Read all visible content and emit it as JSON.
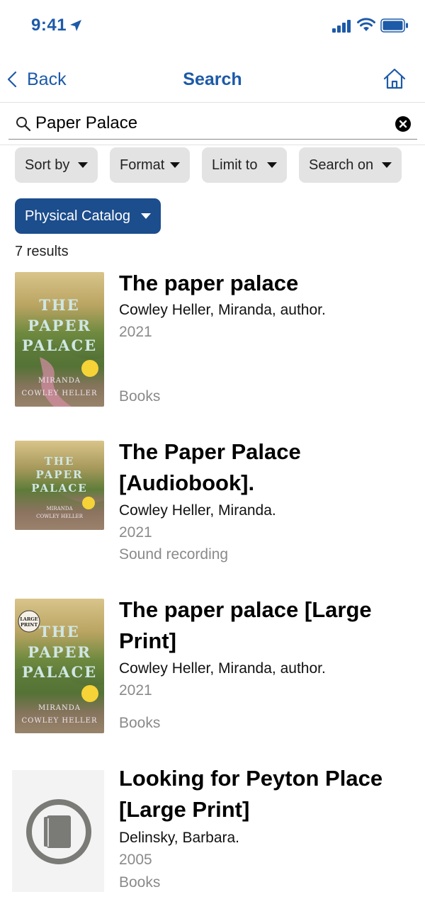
{
  "status_bar": {
    "time": "9:41"
  },
  "nav": {
    "back_label": "Back",
    "title": "Search"
  },
  "search": {
    "value": "Paper Palace",
    "placeholder": ""
  },
  "filters": [
    {
      "label": "Sort by"
    },
    {
      "label": "Format"
    },
    {
      "label": "Limit to"
    },
    {
      "label": "Search on"
    }
  ],
  "catalog_selector": {
    "label": "Physical Catalog"
  },
  "results_count": "7 results",
  "results": [
    {
      "title": "The paper palace",
      "author": "Cowley Heller, Miranda, author.",
      "year": "2021",
      "format": "Books",
      "cover": {
        "line1": "THE",
        "line2": "PAPER",
        "line3": "PALACE",
        "author_line1": "MIRANDA",
        "author_line2": "COWLEY HELLER"
      }
    },
    {
      "title": "The Paper Palace [Audiobook].",
      "author": "Cowley Heller, Miranda.",
      "year": "2021",
      "format": "Sound recording",
      "cover": {
        "line1": "THE",
        "line2": "PAPER",
        "line3": "PALACE",
        "author_line1": "MIRANDA",
        "author_line2": "COWLEY HELLER"
      }
    },
    {
      "title": "The paper palace [Large Print]",
      "author": "Cowley Heller, Miranda, author.",
      "year": "2021",
      "format": "Books",
      "cover": {
        "badge_line1": "LARGE",
        "badge_line2": "PRINT",
        "line1": "THE",
        "line2": "PAPER",
        "line3": "PALACE",
        "author_line1": "MIRANDA",
        "author_line2": "COWLEY HELLER"
      }
    },
    {
      "title": "Looking for Peyton Place [Large Print]",
      "author": "Delinsky, Barbara.",
      "year": "2005",
      "format": "Books",
      "cover_icon": "book-placeholder-icon"
    }
  ],
  "colors": {
    "accent": "#1d5aa8",
    "catalog_button": "#1c4d8c",
    "filter_bg": "#e3e3e3",
    "muted_text": "#8a8a8a"
  }
}
